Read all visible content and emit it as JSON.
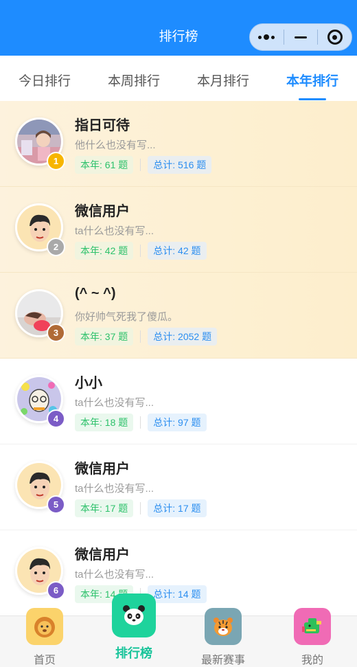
{
  "header": {
    "title": "排行榜"
  },
  "tabs": [
    {
      "label": "今日排行",
      "active": false
    },
    {
      "label": "本周排行",
      "active": false
    },
    {
      "label": "本月排行",
      "active": false
    },
    {
      "label": "本年排行",
      "active": true
    }
  ],
  "ranking": [
    {
      "rank": "1",
      "name": "指日可待",
      "bio": "他什么也没有写...",
      "year_count": "本年: 61 题",
      "total_count": "总计: 516 题",
      "badge_color": "#f7b500",
      "avatar": "photo-girl",
      "highlight": true
    },
    {
      "rank": "2",
      "name": "微信用户",
      "bio": "ta什么也没有写...",
      "year_count": "本年: 42 题",
      "total_count": "总计: 42 题",
      "badge_color": "#a9a9a9",
      "avatar": "cartoon-face",
      "highlight": true
    },
    {
      "rank": "3",
      "name": "(^ ~ ^)",
      "bio": "你好帅气死我了傻瓜。",
      "year_count": "本年: 37 题",
      "total_count": "总计: 2052 题",
      "badge_color": "#b06a36",
      "avatar": "photo-child",
      "highlight": true
    },
    {
      "rank": "4",
      "name": "小小",
      "bio": "ta什么也没有写...",
      "year_count": "本年: 18 题",
      "total_count": "总计: 97 题",
      "badge_color": "#7b5cc6",
      "avatar": "colorful-drawing",
      "highlight": false
    },
    {
      "rank": "5",
      "name": "微信用户",
      "bio": "ta什么也没有写...",
      "year_count": "本年: 17 题",
      "total_count": "总计: 17 题",
      "badge_color": "#7b5cc6",
      "avatar": "cartoon-face",
      "highlight": false
    },
    {
      "rank": "6",
      "name": "微信用户",
      "bio": "ta什么也没有写...",
      "year_count": "本年: 14 题",
      "total_count": "总计: 14 题",
      "badge_color": "#7b5cc6",
      "avatar": "cartoon-face",
      "highlight": false
    }
  ],
  "bottom_nav": [
    {
      "label": "首页",
      "icon": "lion-icon",
      "bg": "#fbd36b",
      "active": false
    },
    {
      "label": "排行榜",
      "icon": "panda-icon",
      "bg": "#1ed39c",
      "active": true
    },
    {
      "label": "最新赛事",
      "icon": "tiger-icon",
      "bg": "#7aa6b3",
      "active": false
    },
    {
      "label": "我的",
      "icon": "dragon-icon",
      "bg": "#f06bb5",
      "active": false
    }
  ],
  "colors": {
    "primary": "#1e8cff",
    "year_tag": "#2cc16a",
    "total_tag": "#2b8ef0",
    "nav_active": "#18c49a"
  }
}
